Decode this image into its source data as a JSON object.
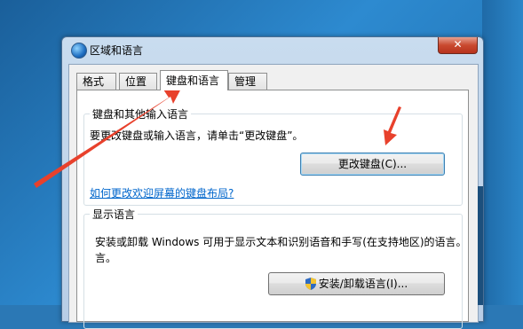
{
  "window": {
    "title": "区域和语言",
    "close_label": "✕"
  },
  "tabs": [
    {
      "label": "格式"
    },
    {
      "label": "位置"
    },
    {
      "label": "键盘和语言",
      "active": true
    },
    {
      "label": "管理"
    }
  ],
  "keyboard_group": {
    "label": "键盘和其他输入语言",
    "description": "要更改键盘或输入语言，请单击“更改键盘”。",
    "button_label": "更改键盘(C)...",
    "link_text": "如何更改欢迎屏幕的键盘布局?"
  },
  "display_group": {
    "label": "显示语言",
    "description_line1": "安装或卸载 Windows 可用于显示文本和识别语音和手写(在支持地区)的语言。",
    "description_line2": "言。",
    "button_label": "安装/卸载语言(I)..."
  },
  "colors": {
    "arrow": "#e8412c",
    "link": "#0066cc"
  },
  "icons": {
    "title": "globe-icon",
    "install_button": "shield-icon"
  }
}
